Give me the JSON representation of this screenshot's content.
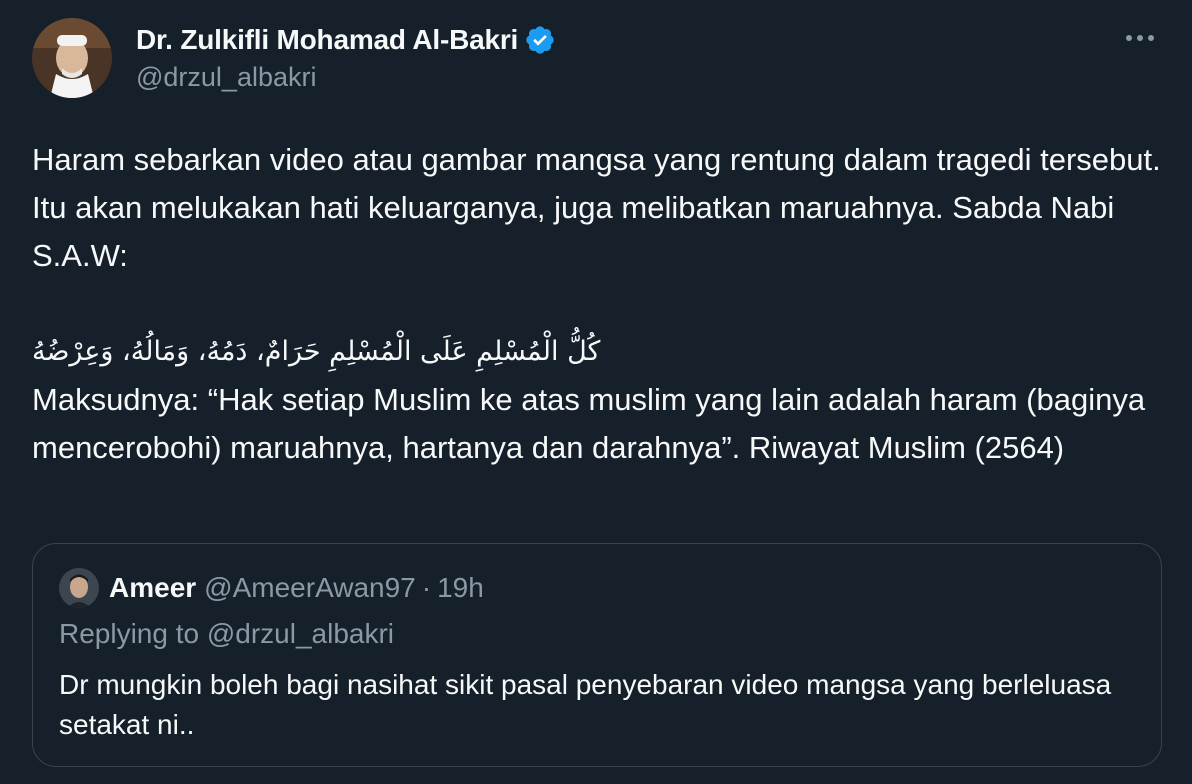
{
  "author": {
    "display_name": "Dr. Zulkifli Mohamad Al-Bakri",
    "handle": "@drzul_albakri",
    "verified": true,
    "avatar_icon": "profile-photo"
  },
  "more_icon": "more-horizontal-icon",
  "tweet": {
    "paragraph1": "Haram sebarkan video atau gambar mangsa yang rentung dalam tragedi tersebut. Itu akan melukakan hati keluarganya, juga melibatkan maruahnya. Sabda Nabi S.A.W:",
    "arabic": "كُلُّ الْمُسْلِمِ عَلَى الْمُسْلِمِ حَرَامٌ، دَمُهُ، وَمَالُهُ، وَعِرْضُهُ",
    "paragraph2": "Maksudnya: “Hak setiap Muslim ke atas muslim yang lain adalah haram (baginya mencerobohi) maruahnya, hartanya dan darahnya”. Riwayat Muslim (2564)"
  },
  "quoted": {
    "display_name": "Ameer",
    "handle": "@AmeerAwan97",
    "separator": "·",
    "time": "19h",
    "replying_to": "Replying to @drzul_albakri",
    "text": "Dr mungkin boleh bagi nasihat sikit pasal penyebaran video mangsa yang berleluasa setakat ni.."
  },
  "colors": {
    "background": "#15202b",
    "text_primary": "#f7f9f9",
    "text_secondary": "#8b98a5",
    "border": "#38444d",
    "verified_blue": "#1d9bf0"
  }
}
